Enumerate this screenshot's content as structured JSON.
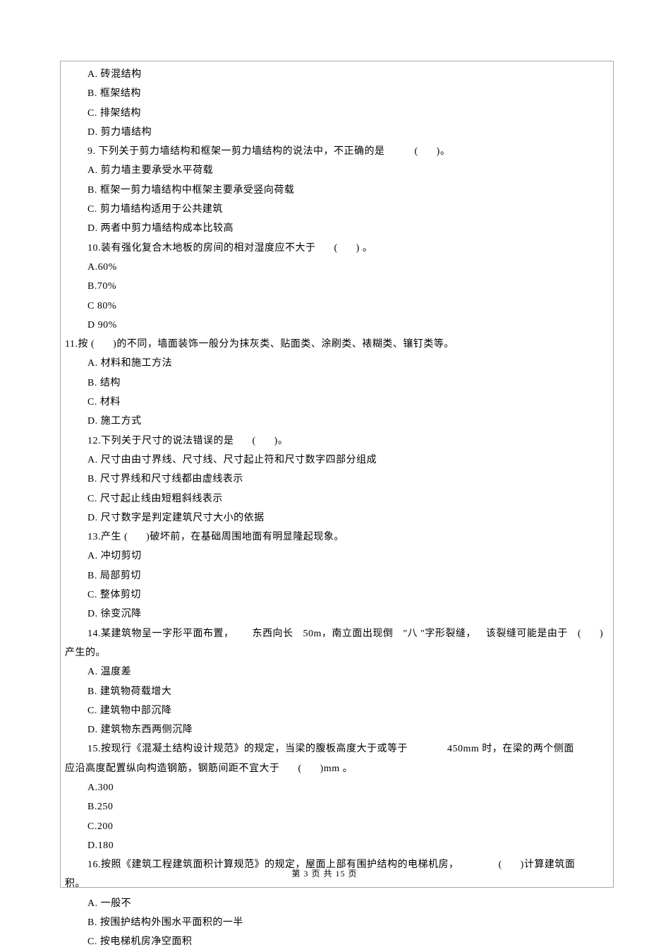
{
  "q8": {
    "optA": "A. 砖混结构",
    "optB": "B. 框架结构",
    "optC": "C. 排架结构",
    "optD": "D. 剪力墙结构"
  },
  "q9": {
    "stem_a": "9. 下列关于剪力墙结构和框架一剪力墙结构的说法中，不正确的是",
    "stem_b": "(",
    "stem_c": ")。",
    "optA": "A. 剪力墙主要承受水平荷载",
    "optB": "B. 框架一剪力墙结构中框架主要承受竖向荷载",
    "optC": "C. 剪力墙结构适用于公共建筑",
    "optD": "D. 两者中剪力墙结构成本比较高"
  },
  "q10": {
    "stem_a": "10.装有强化复合木地板的房间的相对湿度应不大于",
    "stem_b": "(",
    "stem_c": ") 。",
    "optA": "A.60%",
    "optB": "B.70%",
    "optC": "C 80%",
    "optD": "D 90%"
  },
  "q11": {
    "stem_a": "11.按 (",
    "stem_b": ")的不同，墙面装饰一般分为抹灰类、贴面类、涂刷类、裱糊类、镶钉类等。",
    "optA": "A. 材料和施工方法",
    "optB": "B. 结构",
    "optC": "C. 材料",
    "optD": "D. 施工方式"
  },
  "q12": {
    "stem_a": "12.下列关于尺寸的说法错误的是",
    "stem_b": "(",
    "stem_c": ")。",
    "optA": "A. 尺寸由由寸界线、尺寸线、尺寸起止符和尺寸数字四部分组成",
    "optB": "B. 尺寸界线和尺寸线都由虚线表示",
    "optC": "C. 尺寸起止线由短粗斜线表示",
    "optD": "D. 尺寸数字是判定建筑尺寸大小的依据"
  },
  "q13": {
    "stem_a": "13.产生 (",
    "stem_b": ")破坏前，在基础周围地面有明显隆起现象。",
    "optA": "A. 冲切剪切",
    "optB": "B. 局部剪切",
    "optC": "C. 整体剪切",
    "optD": "D. 徐变沉降"
  },
  "q14": {
    "stem_a": "14.某建筑物呈一字形平面布置，",
    "stem_b": "东西向长",
    "stem_c": "50m，南立面出现倒",
    "stem_d": "\"八 \"字形裂缝，",
    "stem_e": "该裂缝可能是由于",
    "stem_f": "(",
    "stem_g": ")",
    "stem2": "产生的。",
    "optA": "A. 温度差",
    "optB": "B. 建筑物荷载增大",
    "optC": "C. 建筑物中部沉降",
    "optD": "D. 建筑物东西两侧沉降"
  },
  "q15": {
    "stem_a": "15.按现行《混凝土结构设计规范》的规定，当梁的腹板高度大于或等于",
    "stem_b": "450mm 时，在梁的两个侧面",
    "stem2_a": "应沿高度配置纵向构造钢筋，钢筋间距不宜大于",
    "stem2_b": "(",
    "stem2_c": ")mm 。",
    "optA": "A.300",
    "optB": "B.250",
    "optC": "C.200",
    "optD": "D.180"
  },
  "q16": {
    "stem_a": "16.按照《建筑工程建筑面积计算规范》的规定，屋面上部有围护结构的电梯机房，",
    "stem_b": "(",
    "stem_c": ")计算建筑面",
    "stem2": "积。",
    "optA": "A. 一般不",
    "optB": "B. 按围护结构外围水平面积的一半",
    "optC": "C. 按电梯机房净空面积"
  },
  "footer": {
    "a": "第",
    "b": "3",
    "c": "页 共",
    "d": "15",
    "e": "页"
  }
}
